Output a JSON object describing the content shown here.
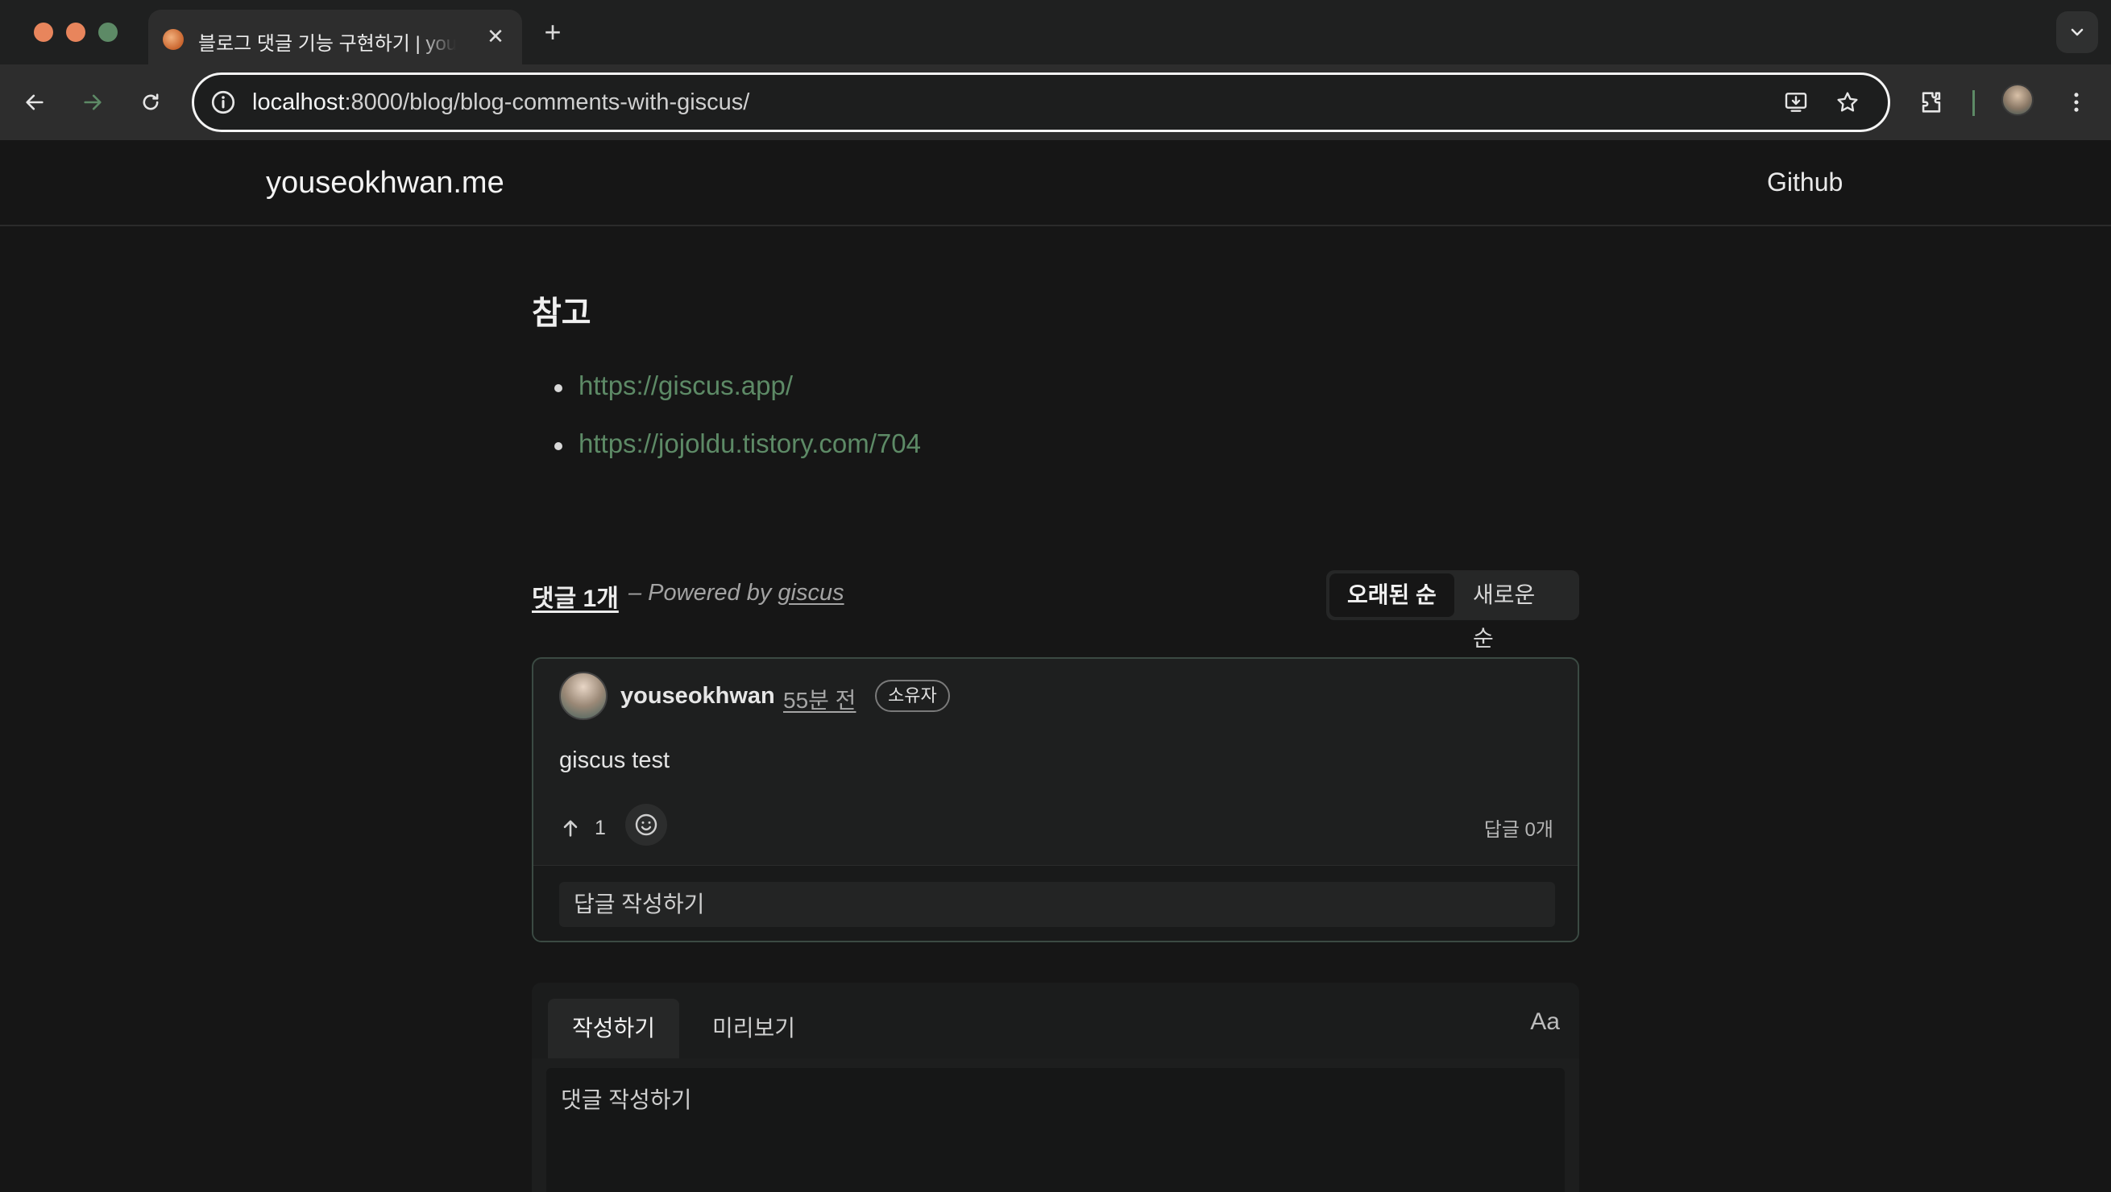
{
  "browser": {
    "tab_title": "블로그 댓글 기능 구현하기 | youseokhwan.me",
    "url_host": "localhost",
    "url_rest": ":8000/blog/blog-comments-with-giscus/",
    "icons": {
      "back": "arrow-left-icon",
      "forward": "arrow-right-icon",
      "reload": "reload-icon",
      "site_info": "info-icon",
      "install": "install-app-icon",
      "bookmark": "star-icon",
      "extensions": "puzzle-icon",
      "menu": "kebab-menu-icon"
    },
    "colors": {
      "close": "#e8855c",
      "minimize": "#e8855c",
      "maximize": "#5d8a66"
    }
  },
  "site": {
    "logo": "youseokhwan.me",
    "nav": {
      "github": "Github"
    }
  },
  "article": {
    "references_heading": "참고",
    "references": [
      {
        "label": "https://giscus.app/"
      },
      {
        "label": "https://jojoldu.tistory.com/704"
      }
    ],
    "link_color": "#5d8a66"
  },
  "giscus": {
    "count_label": "댓글 1개",
    "powered_prefix": "– Powered by ",
    "powered_link": "giscus",
    "sort": {
      "oldest": "오래된 순",
      "newest": "새로운 순",
      "active": "oldest"
    },
    "comment": {
      "author": "youseokhwan",
      "time": "55분 전",
      "badge": "소유자",
      "body": "giscus test",
      "upvotes": "1",
      "replies": "답글 0개",
      "reply_placeholder": "답글 작성하기"
    },
    "editor": {
      "tab_write": "작성하기",
      "tab_preview": "미리보기",
      "format_toggle": "Aa",
      "placeholder": "댓글 작성하기",
      "active_tab": "write"
    }
  }
}
